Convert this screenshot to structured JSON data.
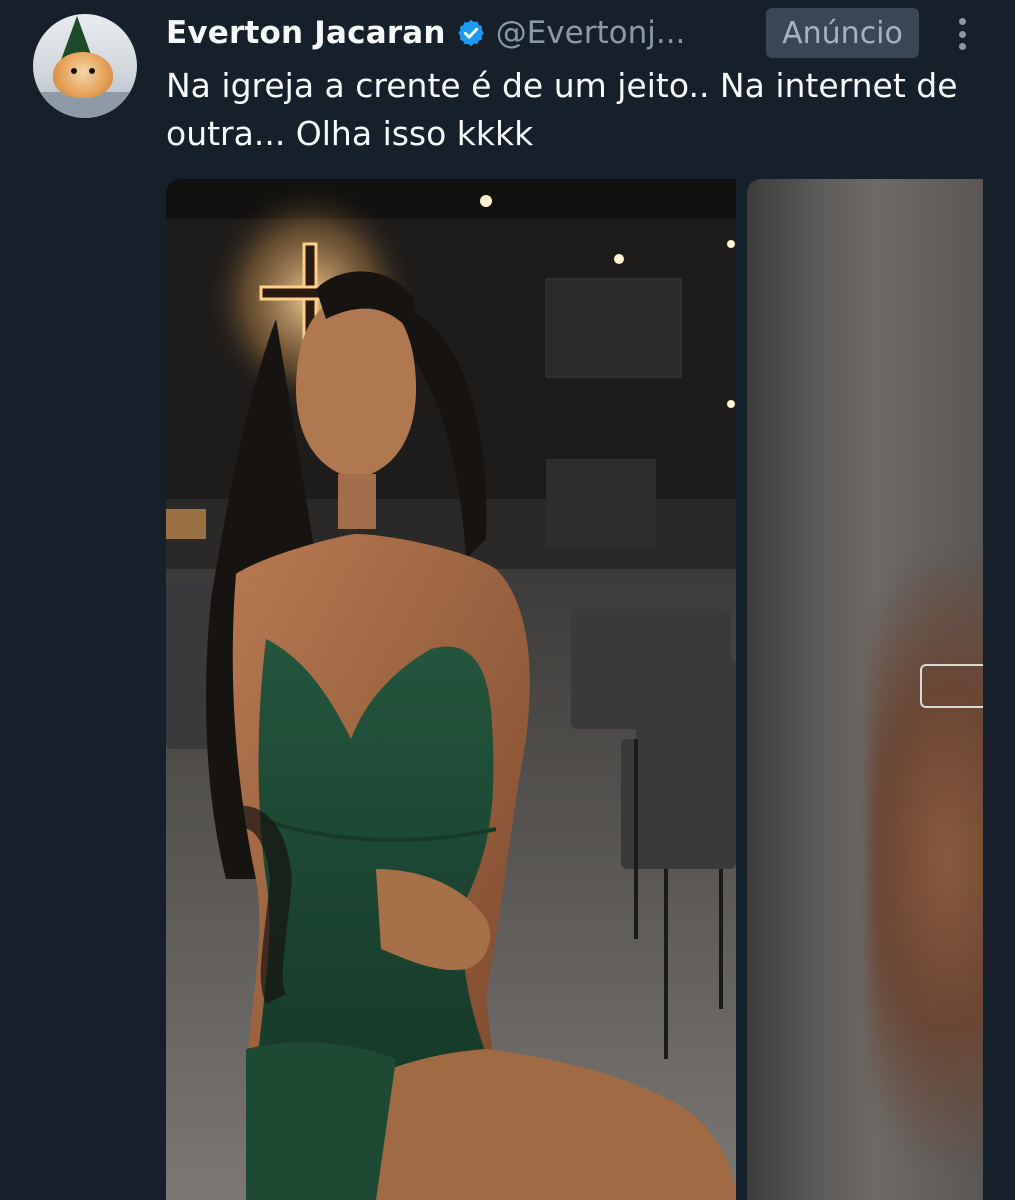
{
  "tweet": {
    "author_name": "Everton Jacaran",
    "handle": "@Evertonj...",
    "ad_label": "Anúncio",
    "text": "Na igreja a crente é de um jeito.. Na internet de outra... Olha isso kkkk"
  },
  "icons": {
    "verified": "verified-badge-icon",
    "more": "more-options-icon"
  },
  "colors": {
    "background": "#15202b",
    "verified": "#1d9bf0",
    "muted": "#8b98a5",
    "ad_badge_bg": "#394654",
    "dress": "#1f4a35"
  }
}
